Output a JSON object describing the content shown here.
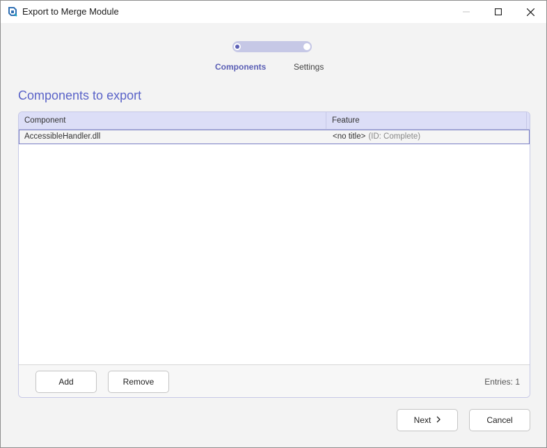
{
  "window": {
    "title": "Export to Merge Module",
    "icon": "advanced-installer-icon"
  },
  "stepper": {
    "steps": [
      {
        "label": "Components",
        "state": "active"
      },
      {
        "label": "Settings",
        "state": "inactive"
      }
    ]
  },
  "section": {
    "title": "Components to export"
  },
  "table": {
    "columns": [
      "Component",
      "Feature"
    ],
    "rows": [
      {
        "component": "AccessibleHandler.dll",
        "feature": "<no title>",
        "feature_id": "(ID: Complete)"
      }
    ]
  },
  "panel_footer": {
    "add_label": "Add",
    "remove_label": "Remove",
    "entries_text": "Entries: 1"
  },
  "actions": {
    "next_label": "Next",
    "cancel_label": "Cancel"
  },
  "colors": {
    "accent": "#5a63c8",
    "track": "#c6c8e6",
    "header_bg": "#dcdef7"
  }
}
